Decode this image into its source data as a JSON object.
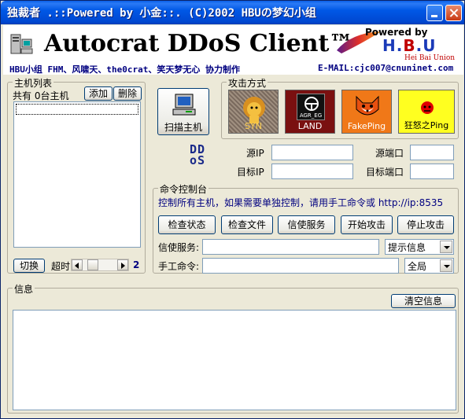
{
  "window": {
    "title": "独裁者 .::Powered by 小金::. (C)2002 HBUの梦幻小组"
  },
  "banner": {
    "app_title": "Autocrat DDoS Client™",
    "credits": "HBU小组 FHM、风啸天、the0crat、笑天梦无心 协力制作",
    "email": "E-MAIL:cjc007@cnuninet.com",
    "powered_by": "Powered by",
    "brand_h": "H.",
    "brand_b": "B",
    "brand_u": ".U",
    "brand_sub": "Hei Bai Union"
  },
  "hosts": {
    "group_label": "主机列表",
    "count_text": "共有 0台主机",
    "add_label": "添加",
    "delete_label": "删除",
    "switch_label": "切换",
    "timeout_label": "超时",
    "timeout_value": "2"
  },
  "scan": {
    "label": "扫描主机"
  },
  "attack": {
    "group_label": "攻击方式",
    "methods": [
      {
        "label": "SYN",
        "color": "#8a7a6e"
      },
      {
        "label": "LAND",
        "color": "#7a1010",
        "badge": "AGR_EG"
      },
      {
        "label": "FakePing",
        "color": "#f07818"
      },
      {
        "label": "狂怒之Ping",
        "color": "#ffff20"
      }
    ]
  },
  "ddos_logo": {
    "line1": "DD",
    "line2": "oS"
  },
  "addresses": {
    "src_ip_label": "源IP",
    "dst_ip_label": "目标IP",
    "src_port_label": "源端口",
    "dst_port_label": "目标端口",
    "src_ip": "",
    "dst_ip": "",
    "src_port": "",
    "dst_port": ""
  },
  "console": {
    "group_label": "命令控制台",
    "hint": "控制所有主机，如果需要单独控制，请用手工命令或 http://ip:8535",
    "buttons": [
      "检查状态",
      "检查文件",
      "信使服务",
      "开始攻击",
      "停止攻击"
    ],
    "messenger_label": "信使服务:",
    "messenger_value": "",
    "messenger_select": "提示信息",
    "manual_label": "手工命令:",
    "manual_value": "",
    "manual_select": "全局"
  },
  "info": {
    "group_label": "信息",
    "clear_label": "清空信息",
    "content": ""
  },
  "colors": {
    "titlebar": "#0058e6",
    "face": "#ece9d8",
    "hint_text": "#000080"
  }
}
